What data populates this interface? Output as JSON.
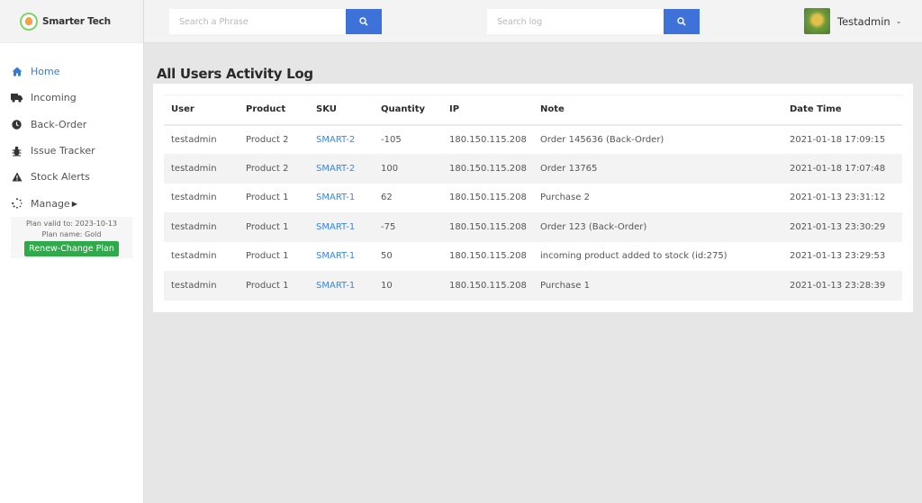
{
  "brand": {
    "name": "Smarter Tech",
    "logo_icon": "lightbulb-icon"
  },
  "header": {
    "search_phrase": {
      "placeholder": "Search a Phrase",
      "value": "",
      "button_icon": "search-icon"
    },
    "search_log": {
      "placeholder": "Search log",
      "value": "",
      "button_icon": "search-icon"
    },
    "user": {
      "name": "Testadmin",
      "avatar": "maple-leaf-avatar",
      "dropdown_icon": "chevron-down-icon"
    }
  },
  "sidebar": {
    "items": [
      {
        "label": "Home",
        "icon": "home-icon",
        "active": true
      },
      {
        "label": "Incoming",
        "icon": "truck-icon",
        "active": false
      },
      {
        "label": "Back-Order",
        "icon": "clock-icon",
        "active": false
      },
      {
        "label": "Issue Tracker",
        "icon": "bug-icon",
        "active": false
      },
      {
        "label": "Stock Alerts",
        "icon": "warning-icon",
        "active": false
      },
      {
        "label": "Manage",
        "icon": "spinner-icon",
        "active": false,
        "has_submenu": true
      }
    ],
    "plan": {
      "valid_to": "Plan valid to: 2023-10-13",
      "name": "Plan name: Gold",
      "renew_label": "Renew-Change Plan"
    }
  },
  "main": {
    "title": "All Users Activity Log",
    "table": {
      "columns": [
        "User",
        "Product",
        "SKU",
        "Quantity",
        "IP",
        "Note",
        "Date Time"
      ],
      "rows": [
        [
          "testadmin",
          "Product 2",
          "SMART-2",
          "-105",
          "180.150.115.208",
          "Order 145636 (Back-Order)",
          "2021-01-18 17:09:15"
        ],
        [
          "testadmin",
          "Product 2",
          "SMART-2",
          "100",
          "180.150.115.208",
          "Order 13765",
          "2021-01-18 17:07:48"
        ],
        [
          "testadmin",
          "Product 1",
          "SMART-1",
          "62",
          "180.150.115.208",
          "Purchase 2",
          "2021-01-13 23:31:12"
        ],
        [
          "testadmin",
          "Product 1",
          "SMART-1",
          "-75",
          "180.150.115.208",
          "Order 123 (Back-Order)",
          "2021-01-13 23:30:29"
        ],
        [
          "testadmin",
          "Product 1",
          "SMART-1",
          "50",
          "180.150.115.208",
          "incoming product added to stock (id:275)",
          "2021-01-13 23:29:53"
        ],
        [
          "testadmin",
          "Product 1",
          "SMART-1",
          "10",
          "180.150.115.208",
          "Purchase 1",
          "2021-01-13 23:28:39"
        ]
      ]
    }
  },
  "colors": {
    "accent": "#3f72d8",
    "link": "#3b86e0",
    "renew_button": "#2eaa4a",
    "active_nav": "#3a7bd5"
  }
}
